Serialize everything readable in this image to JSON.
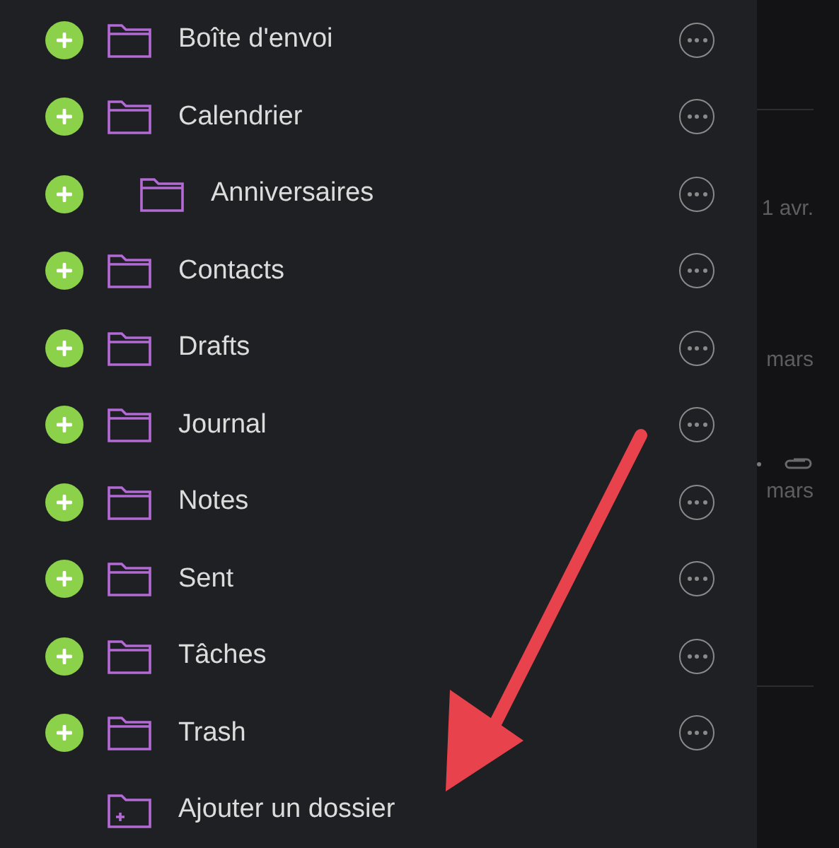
{
  "folders": [
    {
      "name": "Boîte d'envoi"
    },
    {
      "name": "Calendrier",
      "children": [
        {
          "name": "Anniversaires"
        }
      ]
    },
    {
      "name": "Contacts"
    },
    {
      "name": "Drafts"
    },
    {
      "name": "Journal"
    },
    {
      "name": "Notes"
    },
    {
      "name": "Sent"
    },
    {
      "name": "Tâches"
    },
    {
      "name": "Trash"
    }
  ],
  "add_folder": "Ajouter un dossier",
  "message_list": [
    {
      "date": "1 avr.",
      "attachment": false,
      "dot": false
    },
    {
      "date": "mars",
      "attachment": false,
      "dot": false
    },
    {
      "date": "mars",
      "attachment": true,
      "dot": true
    }
  ]
}
